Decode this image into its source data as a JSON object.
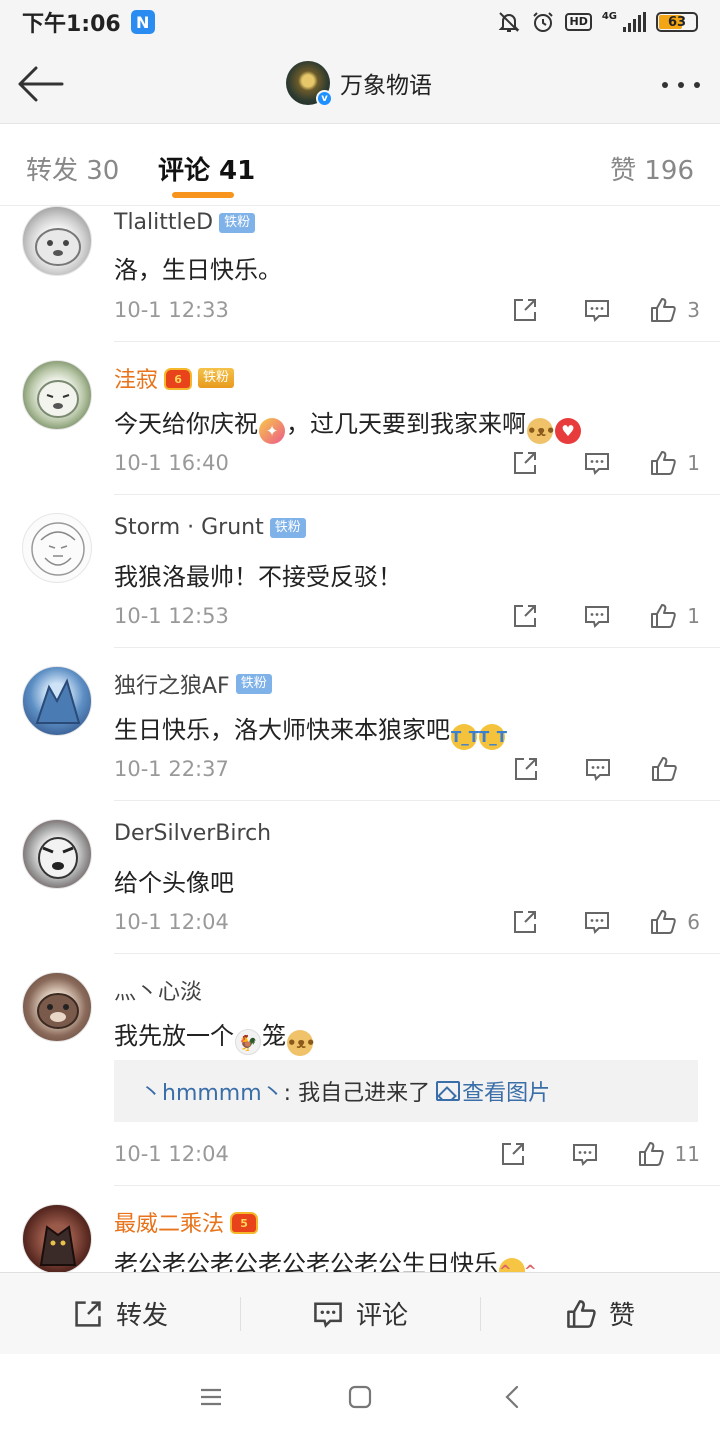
{
  "status_bar": {
    "time": "下午1:06",
    "notification_badge": "N",
    "network_type": "4G",
    "hd_label": "HD",
    "battery_level": "63"
  },
  "header": {
    "title": "万象物语",
    "verified_mark": "v"
  },
  "tabs": {
    "repost": "转发 30",
    "comment": "评论 41",
    "like": "赞 196"
  },
  "comments": [
    {
      "username": "TlalittleD",
      "badge": "铁粉",
      "text": "洛，生日快乐。",
      "time": "10-1 12:33",
      "likes": "3"
    },
    {
      "username": "洼寂",
      "badge": "铁粉",
      "crown_level": "6",
      "text_parts": [
        "今天给你庆祝",
        "，过几天要到我家来啊"
      ],
      "time": "10-1 16:40",
      "likes": "1"
    },
    {
      "username": "Storm · Grunt",
      "badge": "铁粉",
      "text": "我狼洛最帅！不接受反驳！",
      "time": "10-1 12:53",
      "likes": "1"
    },
    {
      "username": "独行之狼AF",
      "badge": "铁粉",
      "text": "生日快乐，洛大师快来本狼家吧",
      "time": "10-1 22:37",
      "likes": ""
    },
    {
      "username": "DerSilverBirch",
      "text": "给个头像吧",
      "time": "10-1 12:04",
      "likes": "6"
    },
    {
      "username": "灬丶心淡",
      "text_parts": [
        "我先放一个",
        "笼"
      ],
      "reply_user": "丶hmmmm丶",
      "reply_text": ": 我自己进来了",
      "reply_link": "查看图片",
      "time": "10-1 12:04",
      "likes": "11"
    },
    {
      "username": "最威二乘法",
      "crown_level": "5",
      "text": "老公老公老公老公老公老公生日快乐"
    }
  ],
  "bottom_bar": {
    "repost": "转发",
    "comment": "评论",
    "like": "赞"
  },
  "colors": {
    "accent": "#f7941d",
    "username_gold": "#e8731a",
    "fan_badge": "#7fb2e8",
    "link": "#3a6ea8"
  }
}
